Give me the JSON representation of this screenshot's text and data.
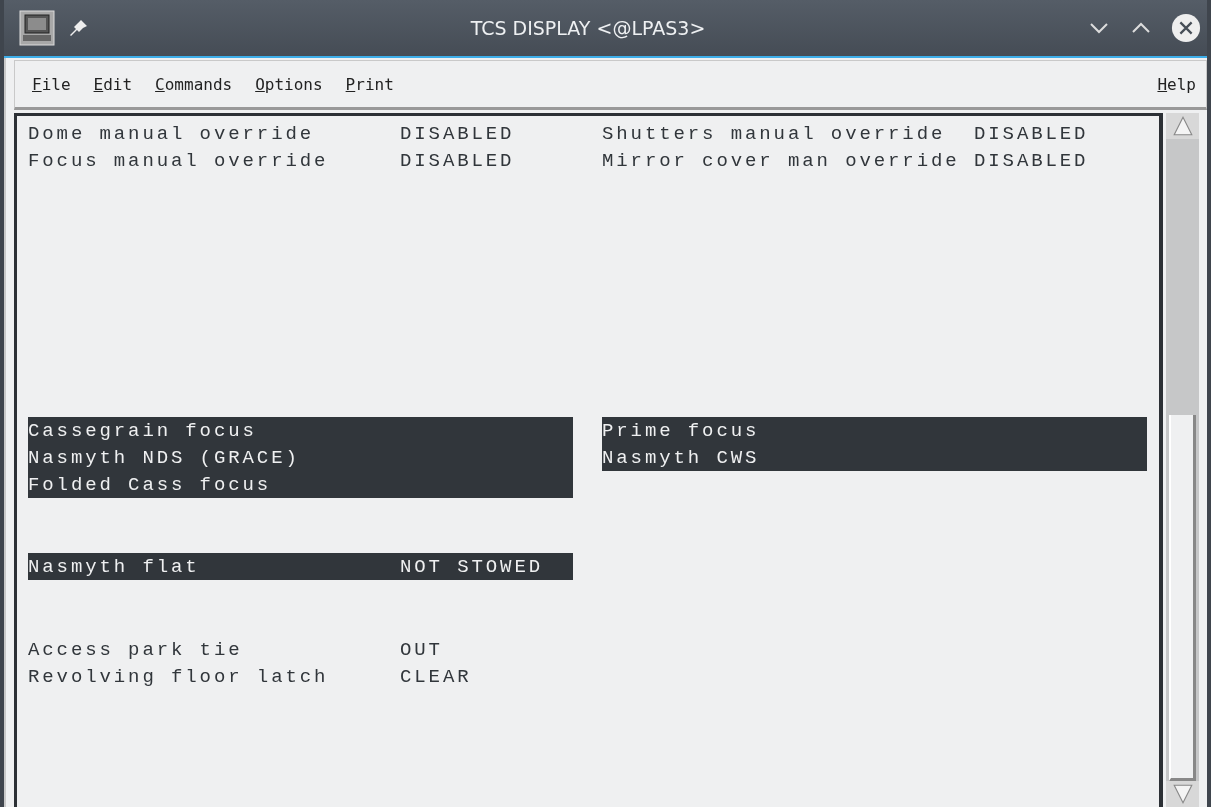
{
  "window": {
    "title": "TCS DISPLAY <@LPAS3>"
  },
  "menu": [
    {
      "label": "File"
    },
    {
      "label": "Edit"
    },
    {
      "label": "Commands"
    },
    {
      "label": "Options"
    },
    {
      "label": "Print"
    }
  ],
  "help_menu": {
    "label": "Help"
  },
  "overrides": {
    "left": [
      {
        "label": "Dome manual override",
        "value": "DISABLED"
      },
      {
        "label": "Focus manual override",
        "value": "DISABLED"
      }
    ],
    "right": [
      {
        "label": "Shutters manual override",
        "value": "DISABLED"
      },
      {
        "label": "Mirror cover man override",
        "value": "DISABLED"
      }
    ]
  },
  "foci": {
    "left": {
      "highlighted": true,
      "items": [
        "Cassegrain focus",
        "Nasmyth NDS (GRACE)",
        "Folded Cass focus"
      ]
    },
    "right": {
      "highlighted": true,
      "items": [
        "Prime focus",
        "Nasmyth CWS"
      ]
    }
  },
  "nasmyth_flat": {
    "label": "Nasmyth flat",
    "value": "NOT STOWED",
    "highlighted": true
  },
  "status": [
    {
      "label": "Access park tie",
      "value": "OUT"
    },
    {
      "label": "Revolving floor latch",
      "value": "CLEAR"
    }
  ]
}
